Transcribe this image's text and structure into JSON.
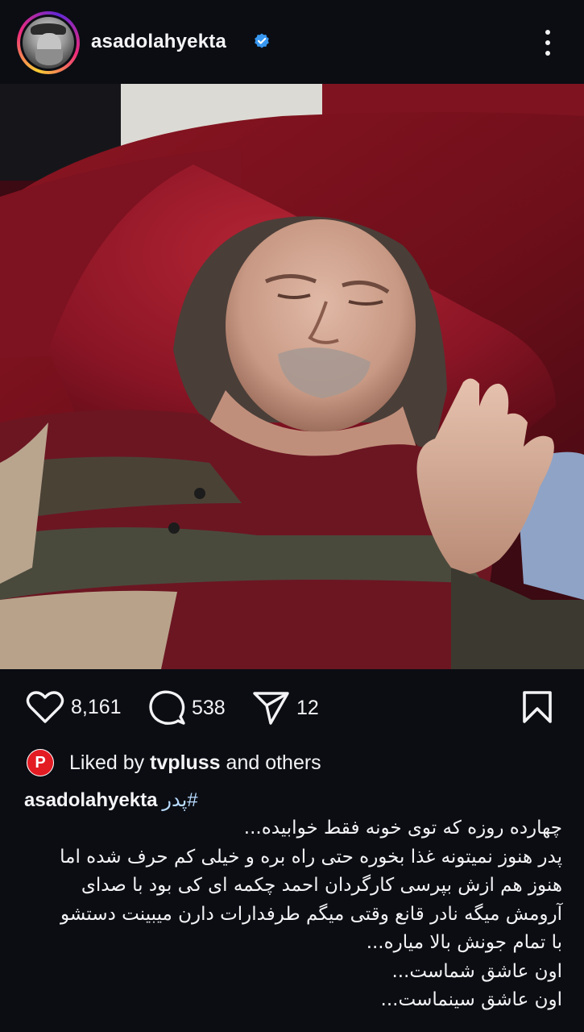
{
  "header": {
    "username": "asadolahyekta",
    "verified": true,
    "avatar_icon": "profile-avatar",
    "more_icon": "more-vertical-icon"
  },
  "post_image": {
    "description_icon": "post-photo"
  },
  "actions": {
    "likes": "8,161",
    "comments": "538",
    "shares": "12"
  },
  "liked_by": {
    "prefix": "Liked by ",
    "user": "tvpluss",
    "suffix": " and others",
    "avatar_letter": "P"
  },
  "caption": {
    "username": "asadolahyekta",
    "hashtag": "#پدر",
    "lines": [
      "چهارده روزه که توی خونه فقط خوابیده...",
      "پدر هنوز نمیتونه غذا بخوره حتی راه بره و خیلی کم حرف شده اما",
      "هنوز هم ازش بپرسی کارگردان احمد چکمه ای کی بود با صدای",
      "آرومش میگه نادر قانع وقتی میگم طرفدارات دارن میبینت دستشو",
      "با تمام جونش بالا میاره...",
      "اون عاشق شماست...",
      "اون عاشق سینماست..."
    ]
  },
  "colors": {
    "background": "#0b0d13",
    "verified": "#3897f0",
    "sofa_red": "#7a1220",
    "text": "#f3f3f5"
  }
}
